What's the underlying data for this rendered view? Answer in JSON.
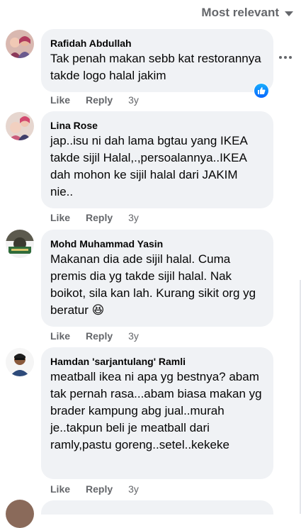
{
  "sort": {
    "label": "Most relevant",
    "icon": "caret-down-icon"
  },
  "more_menu": {
    "icon": "ellipsis-icon"
  },
  "comments": [
    {
      "author": "Rafidah Abdullah",
      "text": "Tak penah makan sebb kat restorannya takde logo halal jakim",
      "actions": {
        "like": "Like",
        "reply": "Reply"
      },
      "time": "3y",
      "reaction": "like-reaction-icon"
    },
    {
      "author": "Lina Rose",
      "text": "jap..isu ni dah lama bgtau yang IKEA takde sijil Halal,.,persoalannya..IKEA dah mohon ke sijil halal dari JAKIM nie..",
      "actions": {
        "like": "Like",
        "reply": "Reply"
      },
      "time": "3y"
    },
    {
      "author": "Mohd Muhammad Yasin",
      "text": "Makanan dia ade sijil halal. Cuma premis dia yg takde sijil halal. Nak boikot, sila kan lah. Kurang sikit org yg beratur",
      "emoji": "😆",
      "actions": {
        "like": "Like",
        "reply": "Reply"
      },
      "time": "3y"
    },
    {
      "author": "Hamdan 'sarjantulang' Ramli",
      "text": "meatball ikea ni apa yg bestnya? abam tak pernah rasa...abam biasa makan yg brader kampung abg jual..murah je..takpun beli je meatball dari ramly,pastu goreng..setel..kekeke",
      "actions": {
        "like": "Like",
        "reply": "Reply"
      },
      "time": "3y"
    }
  ],
  "colors": {
    "bubble": "#f0f2f5",
    "secondary_text": "#65676b",
    "like_blue": "#0866ff"
  }
}
